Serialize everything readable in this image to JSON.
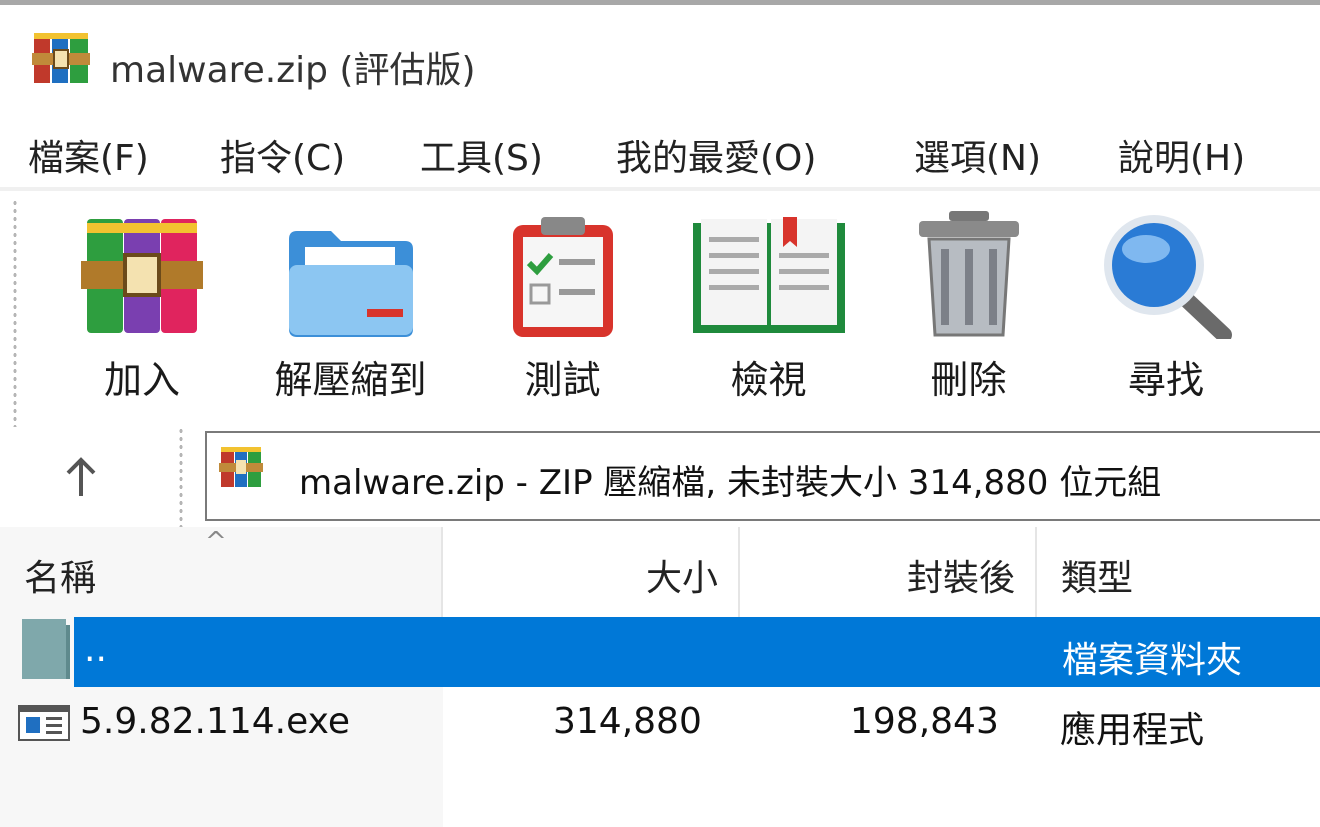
{
  "window": {
    "title": "malware.zip (評估版)",
    "app_icon": "winrar-books-icon"
  },
  "menu": {
    "items": [
      "檔案(F)",
      "指令(C)",
      "工具(S)",
      "我的最愛(O)",
      "選項(N)",
      "說明(H)"
    ]
  },
  "toolbar": {
    "buttons": [
      {
        "label": "加入",
        "icon": "winrar-add-icon"
      },
      {
        "label": "解壓縮到",
        "icon": "folder-extract-icon"
      },
      {
        "label": "測試",
        "icon": "clipboard-check-icon"
      },
      {
        "label": "檢視",
        "icon": "open-book-icon"
      },
      {
        "label": "刪除",
        "icon": "trash-can-icon"
      },
      {
        "label": "尋找",
        "icon": "magnifier-icon"
      }
    ]
  },
  "address": {
    "up_icon": "up-arrow-icon",
    "text": "malware.zip - ZIP 壓縮檔, 未封裝大小 314,880 位元組"
  },
  "file_list": {
    "columns": [
      "名稱",
      "大小",
      "封裝後",
      "類型"
    ],
    "rows": [
      {
        "name": "..",
        "size": "",
        "packed": "",
        "type": "檔案資料夾",
        "selected": true,
        "icon": "folder-icon"
      },
      {
        "name": "5.9.82.114.exe",
        "size": "314,880",
        "packed": "198,843",
        "type": "應用程式",
        "selected": false,
        "icon": "exe-file-icon"
      }
    ]
  },
  "colors": {
    "selection": "#0078d7",
    "header_divider": "#e5e5e5"
  }
}
